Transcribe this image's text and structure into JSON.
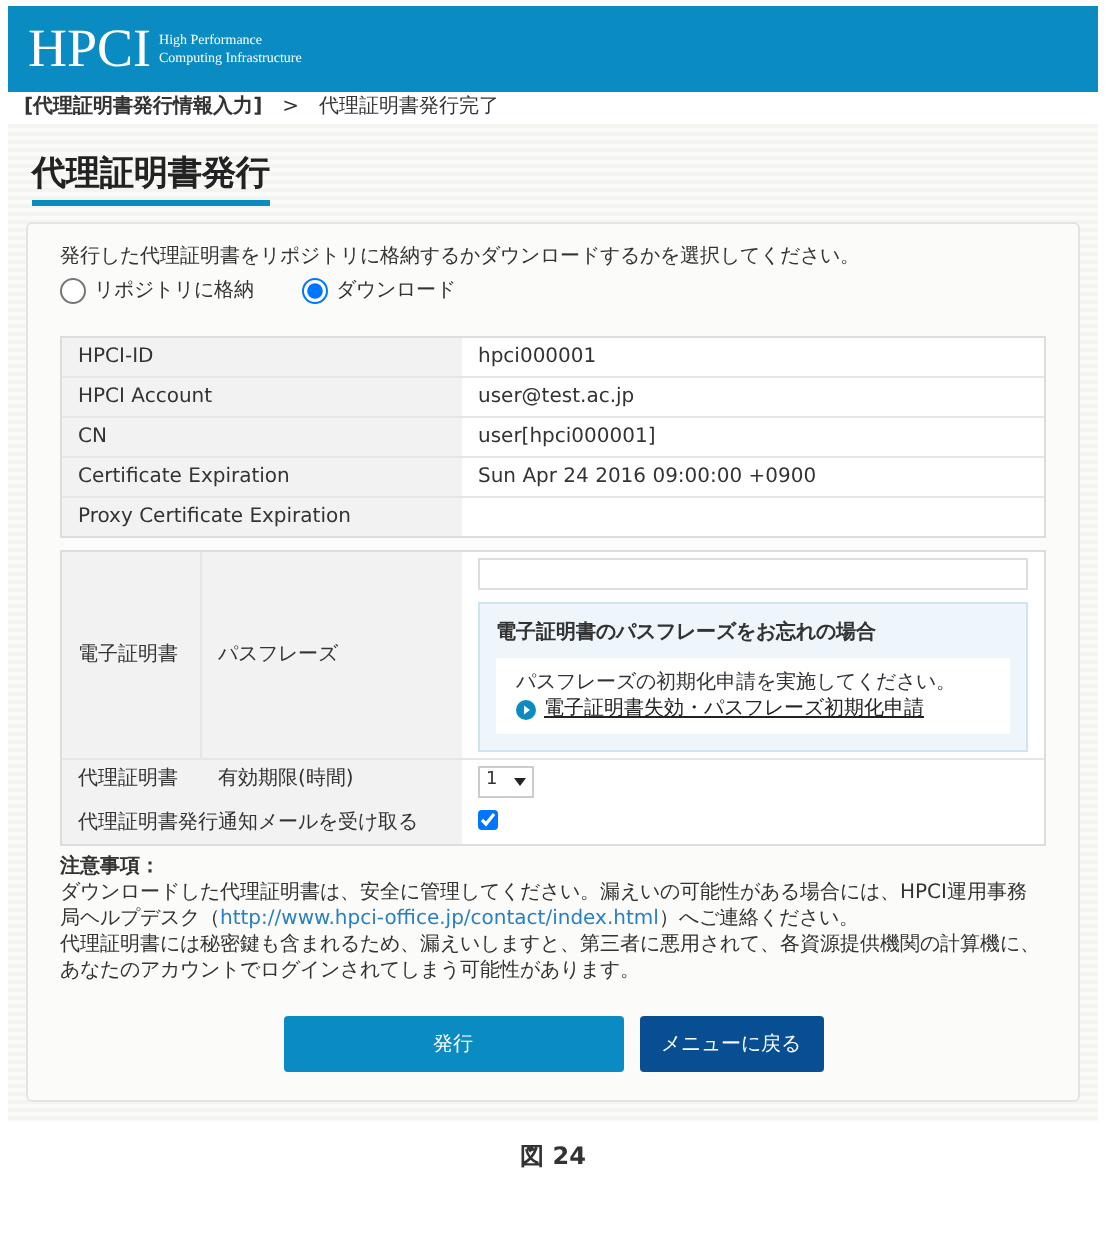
{
  "header": {
    "logo": "HPCI",
    "logo_sub": [
      "High Performance",
      "Computing Infrastructure"
    ]
  },
  "breadcrumb": [
    {
      "label": "[代理証明書発行情報入力]",
      "selected": true
    },
    {
      "label": ">",
      "selected": false
    },
    {
      "label": "代理証明書発行完了",
      "selected": false
    }
  ],
  "title": "代理証明書発行",
  "instruction": "発行した代理証明書をリポジトリに格納するかダウンロードするかを選択してください。",
  "radios": [
    {
      "label": "リポジトリに格納",
      "selected": false
    },
    {
      "label": "ダウンロード",
      "selected": true
    }
  ],
  "info_table": [
    {
      "label": "HPCI-ID",
      "value": "hpci000001"
    },
    {
      "label": "HPCI Account",
      "value": "user@test.ac.jp"
    },
    {
      "label": "CN",
      "value": "user[hpci000001]"
    },
    {
      "label": "Certificate Expiration",
      "value": "Sun Apr 24 2016 09:00:00 +0900"
    },
    {
      "label": "Proxy Certificate Expiration"
    }
  ],
  "passphrase": {
    "group": "電子証明書",
    "label": "パスフレーズ",
    "help_title": "電子証明書のパスフレーズをお忘れの場合",
    "help_text": "パスフレーズの初期化申請を実施してください。",
    "help_link": "電子証明書失効・パスフレーズ初期化申請"
  },
  "validity": {
    "group": "代理証明書",
    "label": "有効期限(時間)",
    "value": "1"
  },
  "mail_option": {
    "label": "代理証明書発行通知メールを受け取る",
    "checked": true
  },
  "notes": {
    "heading": "注意事項：",
    "line1_before": "ダウンロードした代理証明書は、安全に管理してください。漏えいの可能性がある場合には、HPCI運用事務局ヘルプデスク（",
    "link": "http://www.hpci-office.jp/contact/index.html",
    "line1_after": "）へご連絡ください。",
    "line2": "代理証明書には秘密鍵も含まれるため、漏えいしますと、第三者に悪用されて、各資源提供機関の計算機に、あなたのアカウントでログインされてしまう可能性があります。"
  },
  "buttons": [
    {
      "label": "発行",
      "kind": "primary"
    },
    {
      "label": "メニューに戻る",
      "kind": "secondary"
    }
  ],
  "caption": "図 24"
}
